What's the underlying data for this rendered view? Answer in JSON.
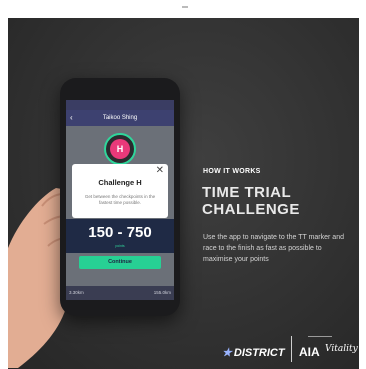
{
  "phone": {
    "nav_title": "Taikoo Shing",
    "back_icon": "chevron-left-icon",
    "pin_letter": "H",
    "modal": {
      "close_symbol": "✕",
      "title": "Challenge H",
      "subtitle": "Get between the checkpoints in the fastest time possible."
    },
    "score_range": "150 - 750",
    "score_note": "points",
    "continue_label": "Continue",
    "distance_left": "3.30km",
    "distance_right": "155.0km"
  },
  "panel": {
    "kicker": "HOW IT WORKS",
    "title_line1": "TIME TRIAL",
    "title_line2": "CHALLENGE",
    "description": "Use the app to navigate to the TT marker and race to the finish as fast as possible to maximise your points"
  },
  "logos": {
    "district": "DISTRICT",
    "district_icon": "star-icon",
    "aia": "AIA",
    "vitality": "Vitality"
  },
  "colors": {
    "accent_green": "#27d094",
    "pin_pink": "#e9397a",
    "navbar": "#3d4170"
  }
}
